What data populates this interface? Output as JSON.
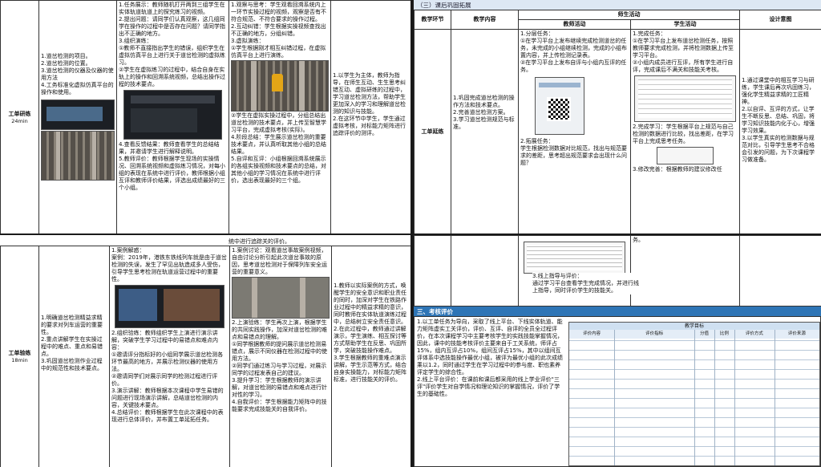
{
  "top_left": {
    "stage": "工单研练",
    "duration": "24min",
    "goals": "1.道岔检测的项目。\n2.道岔检测的位置。\n3.道岔检测的仪器及仪器的使用方法\n4.工务标准化虚拟仿真平台的操作和使用。",
    "teacher_text_1": "1.任务展示：教师随机打开两到三组学生在实体轨道轨道上的探究练习的视频。\n2.提出问题：请同学们认真观察，这几组同学在操作的过程中是否存在问题？请同学指出不正确的地方。\n3.组织演练：\n①教师不直接指出学生的错误，组织学生在虚拟仿真平台上进行关于道岔检测的虚拟练习。\n②学生在虚拟练习的过程中，结合自身在实轨上的操作和回溯系统视频，总结出操作过程的技术要点。",
    "teacher_text_2": "4.查看反馈结果：教师查看学生的总结结果，并邀请学生进行解释说明。\n5.教师评价：教师根据学生现场的实操情况、回溯系统视频和虚拟练习情况，对每小组的表现在系统中进行评价，教师根据小组互评和教师评价结果，评选出成绩最好的三个小组。",
    "student_text_1": "1.观察与思考：学生观看回溯系统内上一环节实操过程的视频，观察是否有不符合规范、不符合要求的操作过程。\n2.互动纠错：学生根据实操视频查找出不正确的地方，分组纠错。\n3.虚拟演练：\n①学生根据刚才相互纠错过程，在虚拟仿真平台上进行演练。",
    "student_text_2": "②学生在虚拟实操过程中，分组总结出道岔检测的技术要点，并上传至智慧学习平台，完成虚拟考核(实际)。\n4.阶段总结：学生展示道岔检测的重要技术要点，并认真听取其他小组的总结结果。\n5.自评和互评：小组根据回溯系统展示的各组实操视频和技术要点的总结，对其他小组的学习情况在系统中进行评价，选出表现最好的三个组。",
    "intent_text": "1.以学生为主体，教师为指导，在师生互动、生生思考纠错互动、虚拟研练的过程中，学习道岔检测方法，帮助学生更加深入的学习和理解道岔检测的知识与技能。\n2.在这环节中学生，学生通过虚拟考核，对标能力矩阵进行追踪评价的测评。"
  },
  "bottom_left": {
    "continued": "统中进行追踪关的评价。",
    "stage": "工单验练",
    "duration": "18min",
    "goals": "1.明确道岔检测精益求精的要求对列车运营的重要性。\n2.重点讲解学生在实操过程中的难点、重点和易错点。\n3.巩固道岔检测作业过程中的规范性和技术要点。",
    "teacher_text_1": "1.案例解惑：\n案例：2019年，港铁东铁线列车就是由于道岔检测的失误，发生了罕见出轨造成多人受伤，引导学生思考检测在轨道运营过程中的重要性。",
    "teacher_text_2": "2.组织验练：教师组织学生上演进行演示讲解，突破学生学习过程中的易错点和难点内容：\n①邀请评分指标好的小组同学展示道岔检测各环节最高的地方，并展示检测仪器的使用方法。\n②邀请同学们对展示同学的检测过程进行评价。\n3.演示讲解：教师根据本次课程中学生易错的问题进行现场演示讲解，总结道岔检测的内容，关键技术要点。\n4.总结评价：教师根据学生在此次课程中的表现进行总体评价，并布置工单延拓任务。",
    "student_text_1": "1.案例讨论：观看道岔事故案例视频，自由讨论分析引起此次道岔事故的原因，思考道岔检测对于保障列车安全运营的重要意义。",
    "student_text_2": "2.上演验练：学生再次上演，根据学生的共同实践操作，加深对道岔检测的难点和易错点的理解。\n①同学根据教师的提问展示道岔检测易错点，展示不同仪器在检测过程中的使用方法。\n②同学们通过练习与学习过程，对展示同学的过程发表自己的建议。\n3.提升学习：学生根据教师的演示讲解，对道岔检测的易错点和难点进行针对性的学习。\n4.自我评价：学生根据能力矩阵中的技能要求完成技能关的自我评价。",
    "intent_text": "1.教师以实际案例的方式，唤醒学生的安全意识和职业责任的同时，加深对学生在铁路作业过程中的精益求精的意识，同时教师在实体轨道演练过程中，总结树立安全责任意识。\n2.在此过程中，教师通过讲解演示，学生演练、相互探讨等方式帮助学生在反思、巩固所学，突破技能操作难点。\n3.学生根据教师的重难点演示讲解，学生示范等方式，结合自身实操能力，对标能力矩阵标准，进行技能关的评价。"
  },
  "top_right": {
    "section_title": "（三）课后巩固拓展",
    "headers": {
      "stage": "教学环节",
      "content": "教学内容",
      "activities": "师生活动",
      "teacher": "教师活动",
      "student": "学生活动",
      "intent": "设计意图"
    },
    "stage": "工单延练",
    "content": "1.巩固完成道岔检测的操作方法和技术要点。\n2.完善道岔检测方案。\n3.学习道岔检测规范与标准。",
    "teacher_text_1": "1.分层任务：\n①在学习平台上发布继续完成检测道岔的任务，未完成的小组继续检测，完成的小组布置内容，并上传检测记录表。\n②在学习平台上发布自评与小组内互评的任务。",
    "teacher_text_2": "2.拓展任务：\n学生根据检测数据对比规范，找出与规范要求的差距，思考超出规范要求会出现什么问题？",
    "student_text_1": "1.完成任务：\n①在学习平台上发布道岔检测任务，按照教师要求完成检测，并将检测数据上传至学习平台。\n②小组内成员进行互评，所有学生进行自评，完成课后不满关和技能关考核。",
    "student_text_2": "2.完成学习：学生根据平台上规范与自己检测的数据进行比较，找出差距，在学习平台上完成思考任务。",
    "student_text_3": "3.修改完善：根据教师的建议修改任",
    "intent_text": "1.通过课堂中的相互学习与研练，学生课后再次巩固练习，强化学生精益求精的工匠精神。\n2.以自评、互评的方式，让学生不断反思、总结、巩固，将学习知识技能内化于心，增强学习效果。\n3.以学生真实的检测数据与规范对比，引导学生思考不合格会引发的问题，为下次课程学习做准备。"
  },
  "bottom_right": {
    "continued_student": "务。",
    "teacher_text_3": "3.线上指导与评价：\n通过学习平台查看学生完成情况，并进行线上指导，同时评价学生的技能关。",
    "eval_title": "三、考核评价",
    "eval_text": "1.以工单任务为导向，采取了线上平台、下线实体轨道、能力矩阵虚实工关评价，评价、互评、自评的全员全过程评价，在本次课程学习中主要考核学生的实践技能掌握情况，因此，课中的技能考核评价主要来自于工关系统，师评占15%，组内互评占10%，组间互评占15%，其中以组间互评体系中选技能操作最优小组，被评为最优小组的此次成绩乘以1.2，同时通过学生在学习过程中的参与度、职也素养评定学生的综合性。\n2.线上平台评价：在课前和课后都采用的线上学业评价\"三评\"评价学生对自学情况和理论知识的掌握情况，评价了学生的基础性。",
    "table_header": "教学目标",
    "table_cols": [
      "评价内容",
      "评价指标",
      "分值",
      "比例",
      "评价方式",
      "评价来源"
    ]
  }
}
